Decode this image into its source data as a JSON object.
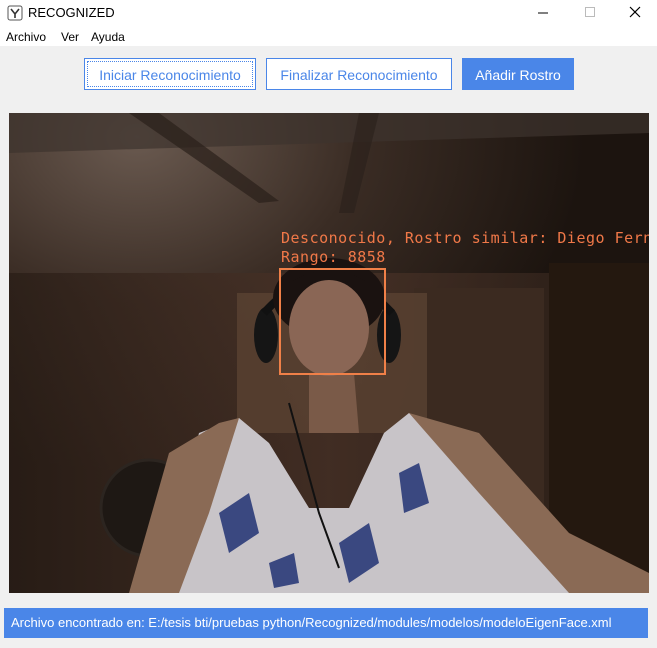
{
  "window": {
    "title": "RECOGNIZED",
    "controls": {
      "minimize": "—",
      "maximize": "☐",
      "close": "✕"
    }
  },
  "menu": {
    "items": [
      "Archivo",
      "Ver",
      "Ayuda"
    ]
  },
  "toolbar": {
    "start_label": "Iniciar Reconocimiento",
    "stop_label": "Finalizar Reconocimiento",
    "add_label": "Añadir Rostro"
  },
  "video": {
    "line1": "Desconocido, Rostro similar: Diego Fernandez",
    "line2": "Rango: 8858"
  },
  "status": {
    "text": "Archivo encontrado en: E:/tesis bti/pruebas python/Recognized/modules/modelos/modeloEigenFace.xml"
  },
  "colors": {
    "accent": "#4a86e8",
    "overlay": "#f07848",
    "window_bg": "#f0f0f0"
  }
}
